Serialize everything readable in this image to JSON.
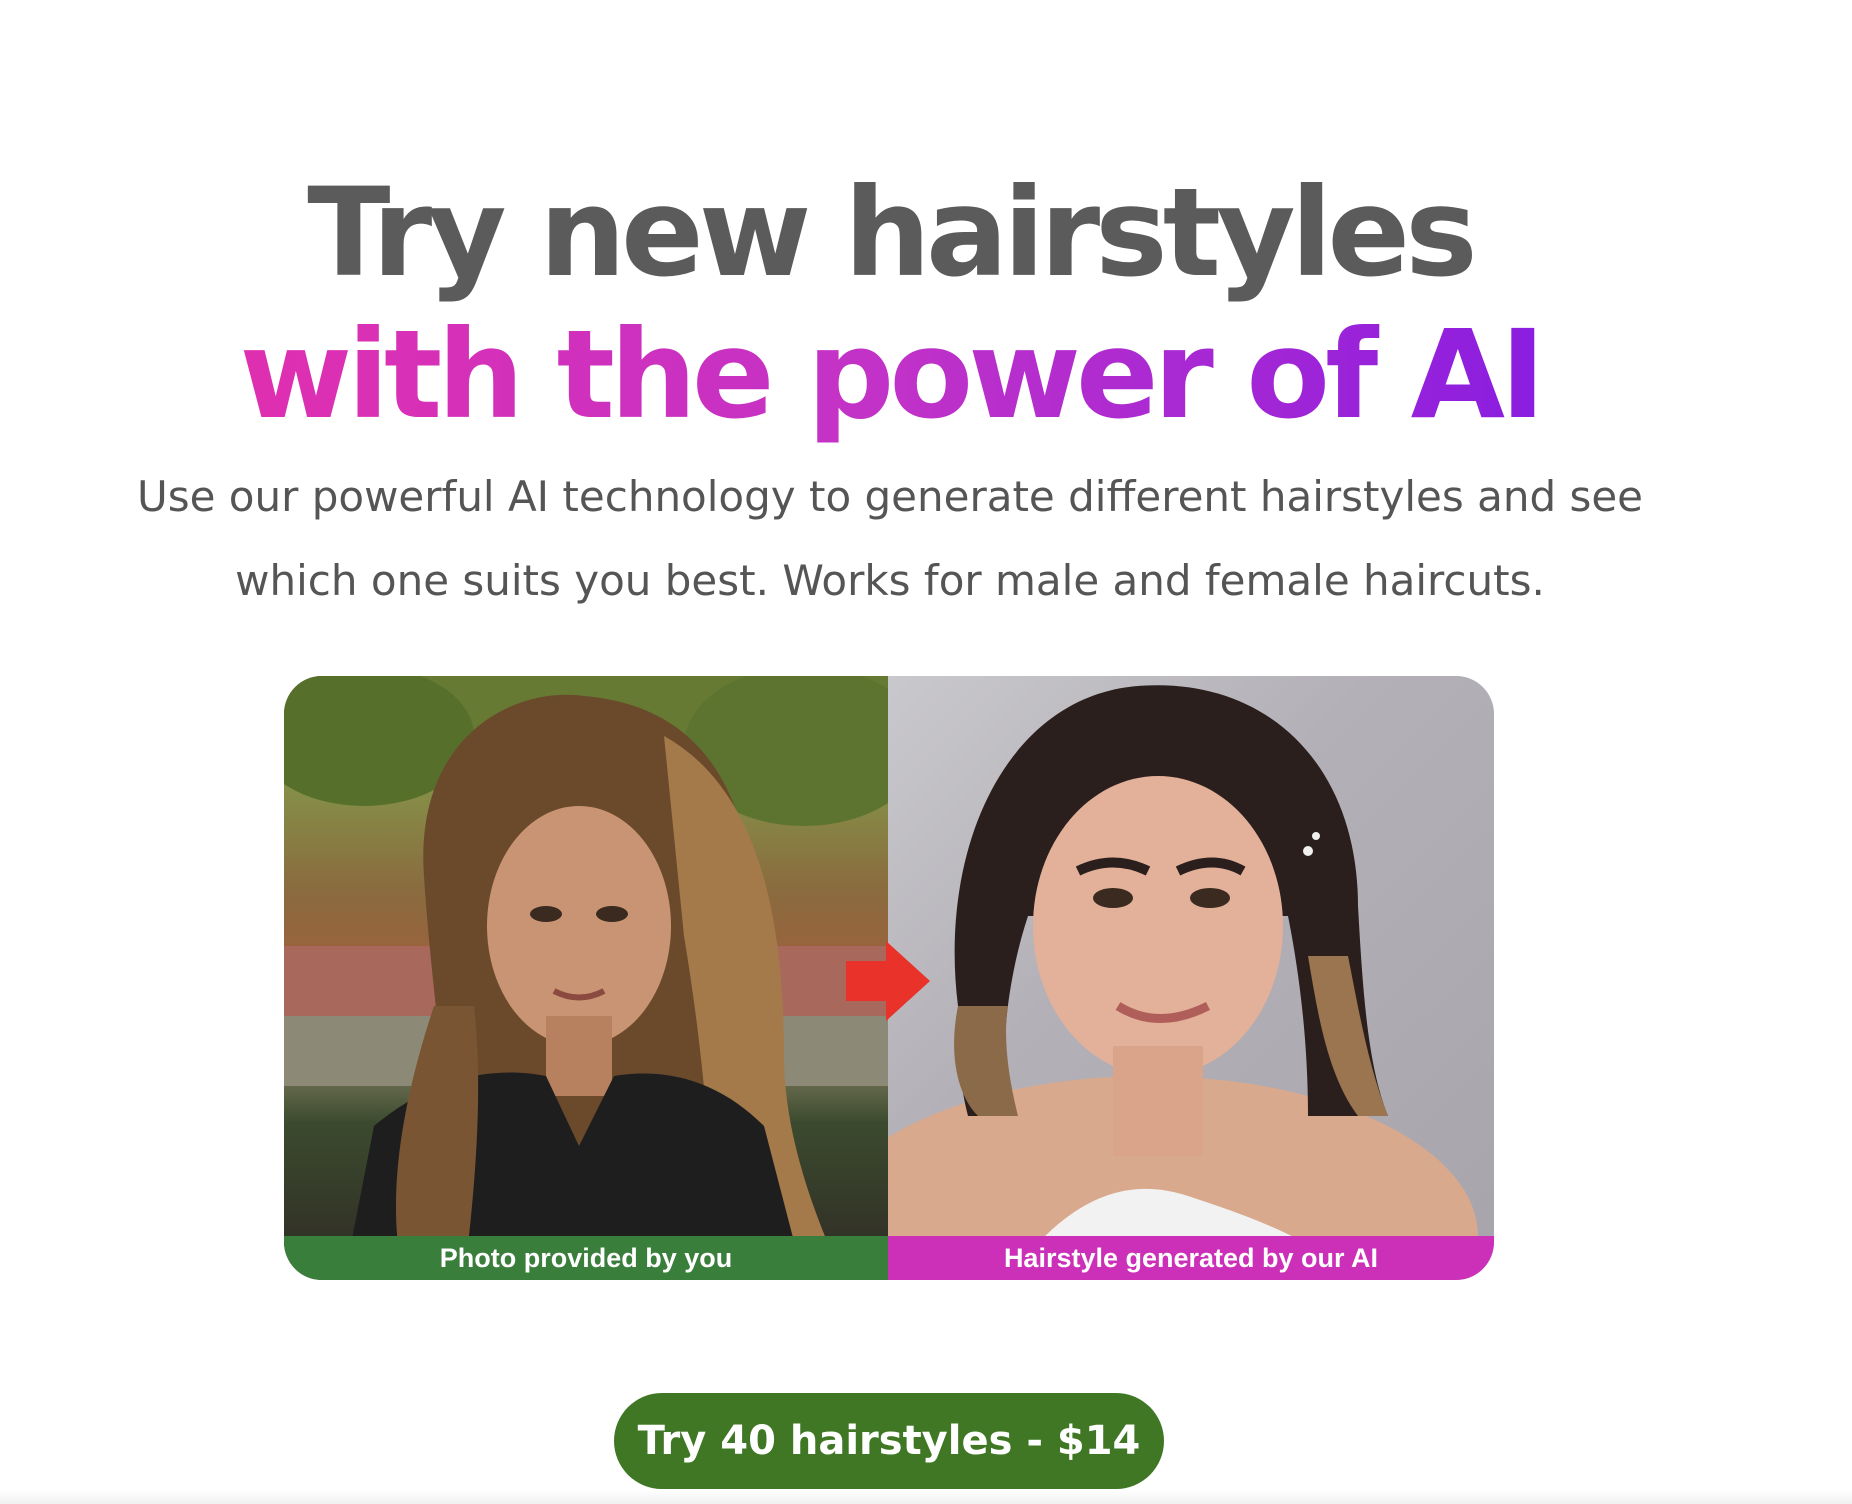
{
  "hero": {
    "title_line_1": "Try new hairstyles",
    "title_line_2": "with the power of AI",
    "subtitle": "Use our powerful AI technology to generate different hairstyles and see which one suits you best. Works for male and female haircuts."
  },
  "comparison": {
    "left_caption": "Photo provided by you",
    "right_caption": "Hairstyle generated by our AI",
    "arrow_icon": "arrow-right-icon"
  },
  "cta": {
    "label": "Try 40 hairstyles - $14"
  },
  "colors": {
    "title_gray": "#5b5b5b",
    "gradient_start": "#e02fb0",
    "gradient_end": "#8a1de0",
    "left_caption_bg": "#3a7e3c",
    "right_caption_bg": "#cc2fb8",
    "cta_bg": "#3f7724",
    "arrow": "#e8322a"
  }
}
